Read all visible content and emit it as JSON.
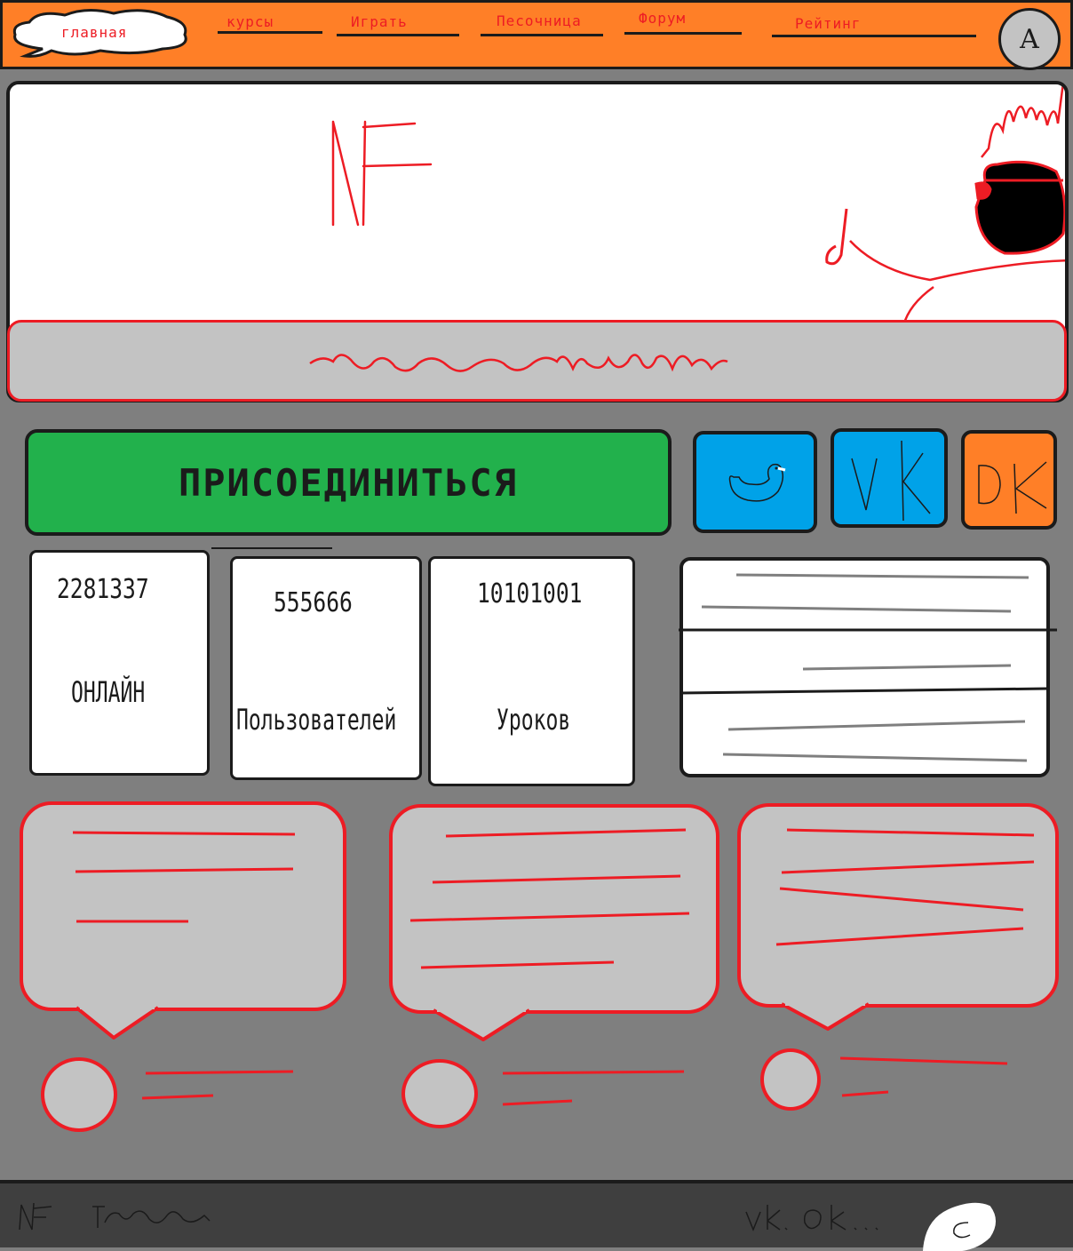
{
  "header": {
    "logo_label": "главная",
    "nav": [
      "курсы",
      "Играть",
      "Песочница",
      "Форум",
      "Рейтинг"
    ],
    "avatar_letter": "A"
  },
  "hero": {
    "logo_text": "NF"
  },
  "actions": {
    "join_label": "ПРИСОЕДИНИТЬСЯ",
    "social": [
      "VK",
      "OK"
    ]
  },
  "stats": [
    {
      "value": "2281337",
      "label": "ОНЛАЙН"
    },
    {
      "value": "555666",
      "label": "Пользователей"
    },
    {
      "value": "10101001",
      "label": "Уроков"
    }
  ],
  "colors": {
    "header": "#ff7f27",
    "accent_red": "#ed1c24",
    "join_green": "#22b14c",
    "social_blue": "#00a2e8",
    "panel_gray": "#c3c3c3",
    "page_gray": "#7f7f7f",
    "footer": "#3f3f3f"
  }
}
